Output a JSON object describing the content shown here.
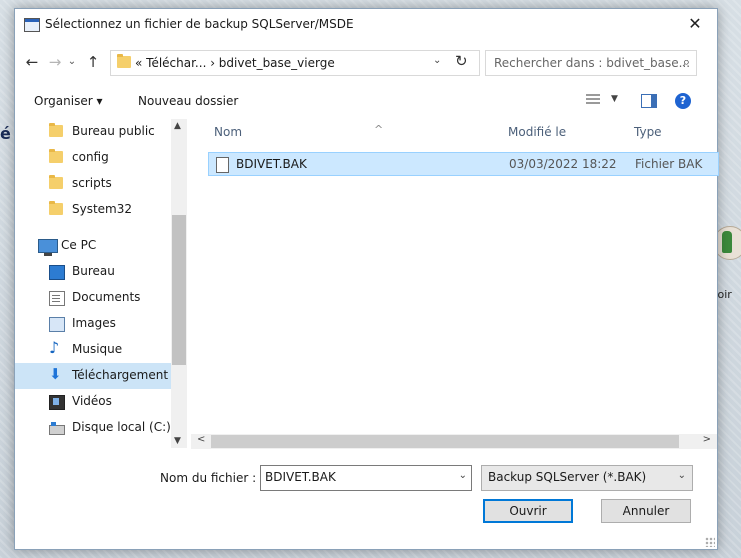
{
  "background": {
    "right_label": "voir",
    "left_char": "é"
  },
  "dialog": {
    "title": "Sélectionnez un fichier de backup SQLServer/MSDE",
    "close_glyph": "✕"
  },
  "address": {
    "path_text": "« Téléchar...  ›  bdivet_base_vierge",
    "search_placeholder": "Rechercher dans : bdivet_base..."
  },
  "toolbar": {
    "organize_label": "Organiser ▾",
    "new_folder_label": "Nouveau dossier",
    "help_glyph": "?"
  },
  "nav": {
    "items": [
      {
        "label": "Bureau public",
        "icon": "folder-icon"
      },
      {
        "label": "config",
        "icon": "folder-icon"
      },
      {
        "label": "scripts",
        "icon": "folder-icon"
      },
      {
        "label": "System32",
        "icon": "folder-icon"
      },
      {
        "label": "Ce PC",
        "icon": "pc-icon"
      },
      {
        "label": "Bureau",
        "icon": "desktop-icon"
      },
      {
        "label": "Documents",
        "icon": "documents-icon"
      },
      {
        "label": "Images",
        "icon": "images-icon"
      },
      {
        "label": "Musique",
        "icon": "music-icon"
      },
      {
        "label": "Téléchargement",
        "icon": "download-icon",
        "selected": true
      },
      {
        "label": "Vidéos",
        "icon": "video-icon"
      },
      {
        "label": "Disque local (C:)",
        "icon": "disk-icon"
      }
    ]
  },
  "filelist": {
    "columns": {
      "name": "Nom",
      "modified": "Modifié le",
      "type": "Type"
    },
    "rows": [
      {
        "name": "BDIVET.BAK",
        "modified": "03/03/2022 18:22",
        "type": "Fichier BAK"
      }
    ]
  },
  "footer": {
    "filename_label": "Nom du fichier :",
    "filename_value": "BDIVET.BAK",
    "filetype_value": "Backup SQLServer (*.BAK)",
    "open_label": "Ouvrir",
    "cancel_label": "Annuler"
  }
}
